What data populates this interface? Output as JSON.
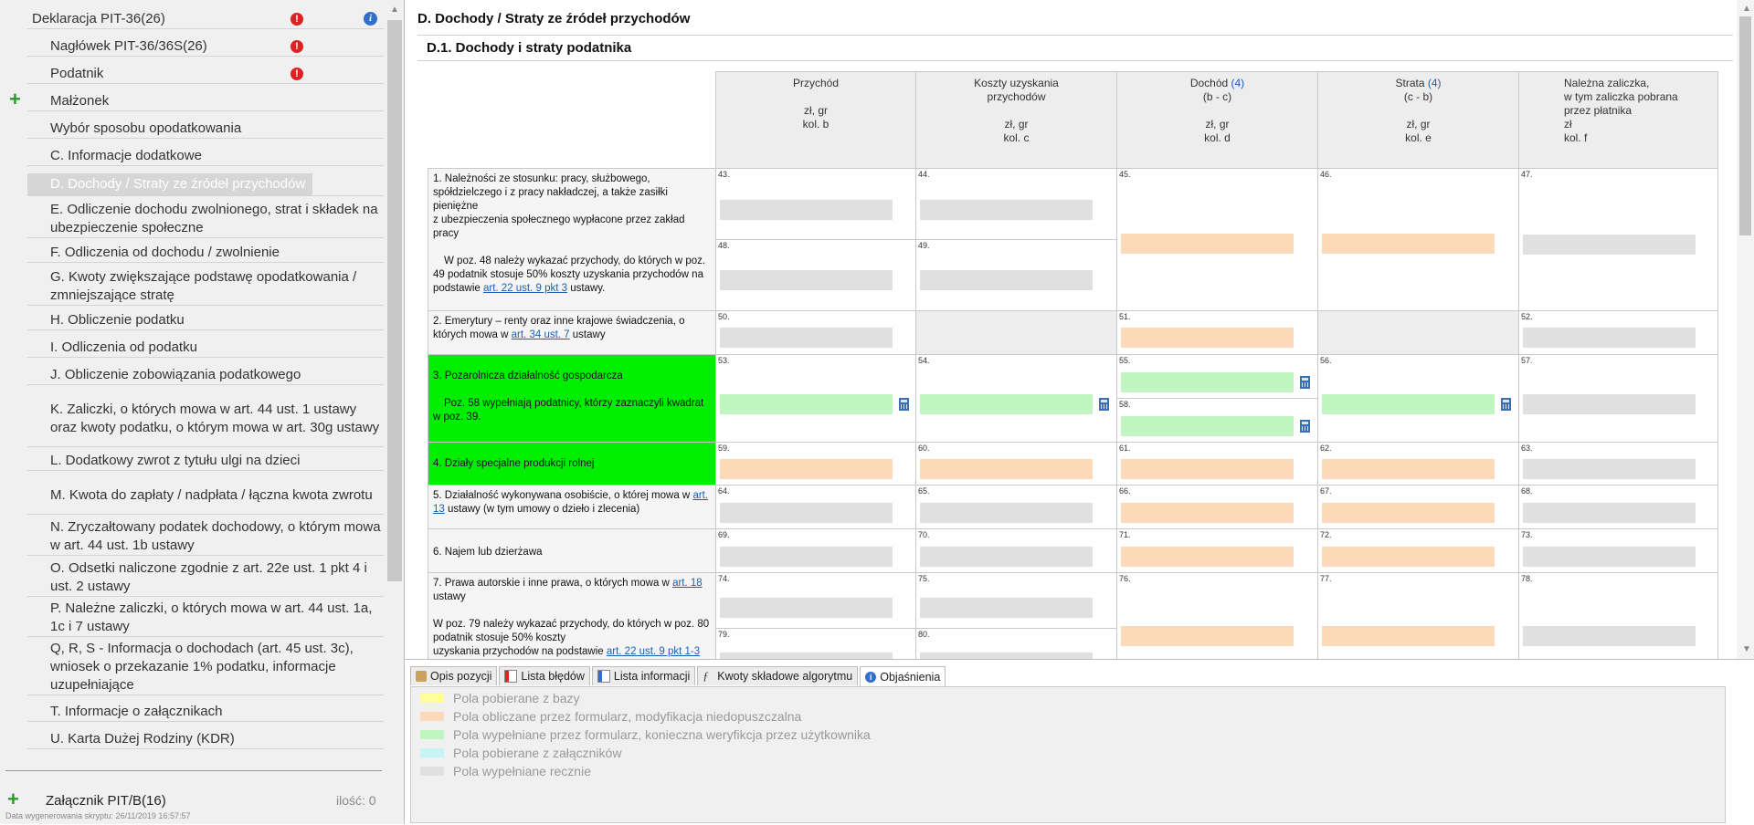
{
  "sidebar": {
    "root": "Deklaracja PIT-36(26)",
    "items": [
      "Nagłówek PIT-36/36S(26)",
      "Podatnik",
      "Małżonek",
      "Wybór sposobu opodatkowania",
      "C. Informacje dodatkowe",
      "D. Dochody / Straty ze źródeł przychodów",
      "E. Odliczenie dochodu zwolnionego, strat i składek na ubezpieczenie społeczne",
      "F. Odliczenia od dochodu / zwolnienie",
      "G. Kwoty zwiększające podstawę opodatkowania / zmniejszające stratę",
      "H. Obliczenie podatku",
      "I. Odliczenia od podatku",
      "J. Obliczenie zobowiązania podatkowego",
      "K. Zaliczki, o których mowa w art. 44 ust. 1 ustawy oraz kwoty podatku, o którym mowa w art. 30g ustawy",
      "L. Dodatkowy zwrot z tytułu ulgi na dzieci",
      "M. Kwota do zapłaty / nadpłata / łączna kwota zwrotu",
      "N. Zryczałtowany podatek dochodowy, o którym mowa w art. 44 ust. 1b ustawy",
      "O. Odsetki naliczone zgodnie z art. 22e ust. 1 pkt 4 i ust. 2 ustawy",
      "P. Należne zaliczki, o których mowa w art. 44 ust. 1a, 1c i 7 ustawy",
      "Q, R, S - Informacja o dochodach (art. 45 ust. 3c), wniosek o przekazanie 1% podatku, informacje uzupełniające",
      "T. Informacje o załącznikach",
      "U. Karta Dużej Rodziny (KDR)"
    ],
    "attachment_label": "Załącznik PIT/B(16)",
    "attachment_count": "ilość: 0",
    "generated_date": "Data wygenerowania skryptu: 26/11/2019 16:57:57"
  },
  "main": {
    "section_title": "D. Dochody / Straty ze źródeł przychodów",
    "subsection_title": "D.1. Dochody i straty podatnika",
    "columns": [
      {
        "line1": "Przychód",
        "line2": "",
        "unit": "zł, gr",
        "col": "kol. b"
      },
      {
        "line1": "Koszty uzyskania",
        "line2": "przychodów",
        "unit": "zł, gr",
        "col": "kol. c"
      },
      {
        "line1": "Dochód ",
        "link": "(4)",
        "line2": "(b - c)",
        "unit": "zł, gr",
        "col": "kol. d"
      },
      {
        "line1": "Strata ",
        "link": "(4)",
        "line2": "(c - b)",
        "unit": "zł, gr",
        "col": "kol. e"
      },
      {
        "line1": "Należna zaliczka,",
        "line2": "w tym zaliczka pobrana",
        "line3": "przez płatnika",
        "unit": "zł",
        "col": "kol. f"
      }
    ],
    "rows": {
      "r1_a": "1. Należności ze stosunku: pracy, służbowego, spółdzielczego i z pracy nakładczej, a także zasiłki pieniężne",
      "r1_b": "z ubezpieczenia społecznego wypłacone przez zakład pracy",
      "r1_c": "W poz. 48 należy wykazać przychody, do których w poz. 49 podatnik stosuje 50% koszty uzyskania przychodów na podstawie ",
      "r1_link": "art. 22 ust. 9 pkt 3",
      "r1_d": " ustawy.",
      "r2_a": "2. Emerytury – renty oraz inne krajowe świadczenia, o których mowa w ",
      "r2_link": "art. 34 ust. 7",
      "r2_b": " ustawy",
      "r3_a": "3. Pozarolnicza działalność gospodarcza",
      "r3_b": "Poz. 58 wypełniają podatnicy, którzy zaznaczyli kwadrat w poz. 39.",
      "r4": "4. Działy specjalne produkcji rolnej",
      "r5_a": "5. Działalność wykonywana osobiście, o której mowa w ",
      "r5_link": "art. 13",
      "r5_b": " ustawy (w tym umowy o dzieło i zlecenia)",
      "r6": "6. Najem lub dzierżawa",
      "r7_a": "7. Prawa autorskie i inne prawa, o których mowa w ",
      "r7_link": "art. 18",
      "r7_b": " ustawy",
      "r7_c": "W poz. 79 należy wykazać przychody, do których w poz. 80 podatnik stosuje 50% koszty",
      "r7_d": "uzyskania przychodów na podstawie ",
      "r7_link2": "art. 22 ust. 9 pkt 1-3"
    },
    "field_numbers": [
      "43.",
      "44.",
      "45.",
      "46.",
      "47.",
      "48.",
      "49.",
      "50.",
      "51.",
      "52.",
      "53.",
      "54.",
      "55.",
      "56.",
      "57.",
      "58.",
      "59.",
      "60.",
      "61.",
      "62.",
      "63.",
      "64.",
      "65.",
      "66.",
      "67.",
      "68.",
      "69.",
      "70.",
      "71.",
      "72.",
      "73.",
      "74.",
      "75.",
      "76.",
      "77.",
      "78.",
      "79.",
      "80."
    ]
  },
  "bottom": {
    "tabs": [
      "Opis pozycji",
      "Lista błędów",
      "Lista informacji",
      "Kwoty składowe algorytmu",
      "Objaśnienia"
    ],
    "legend": [
      {
        "label": "Pola pobierane z bazy",
        "color": "#ffff99"
      },
      {
        "label": "Pola obliczane przez formularz, modyfikacja niedopuszczalna",
        "color": "#fcd9b8"
      },
      {
        "label": "Pola wypełniane przez formularz, konieczna weryfikcja przez użytkownika",
        "color": "#c0f5bf"
      },
      {
        "label": "Pola pobierane z załączników",
        "color": "#c6f3f3"
      },
      {
        "label": "Pola wypełniane recznie",
        "color": "#e0e0e0"
      }
    ]
  }
}
